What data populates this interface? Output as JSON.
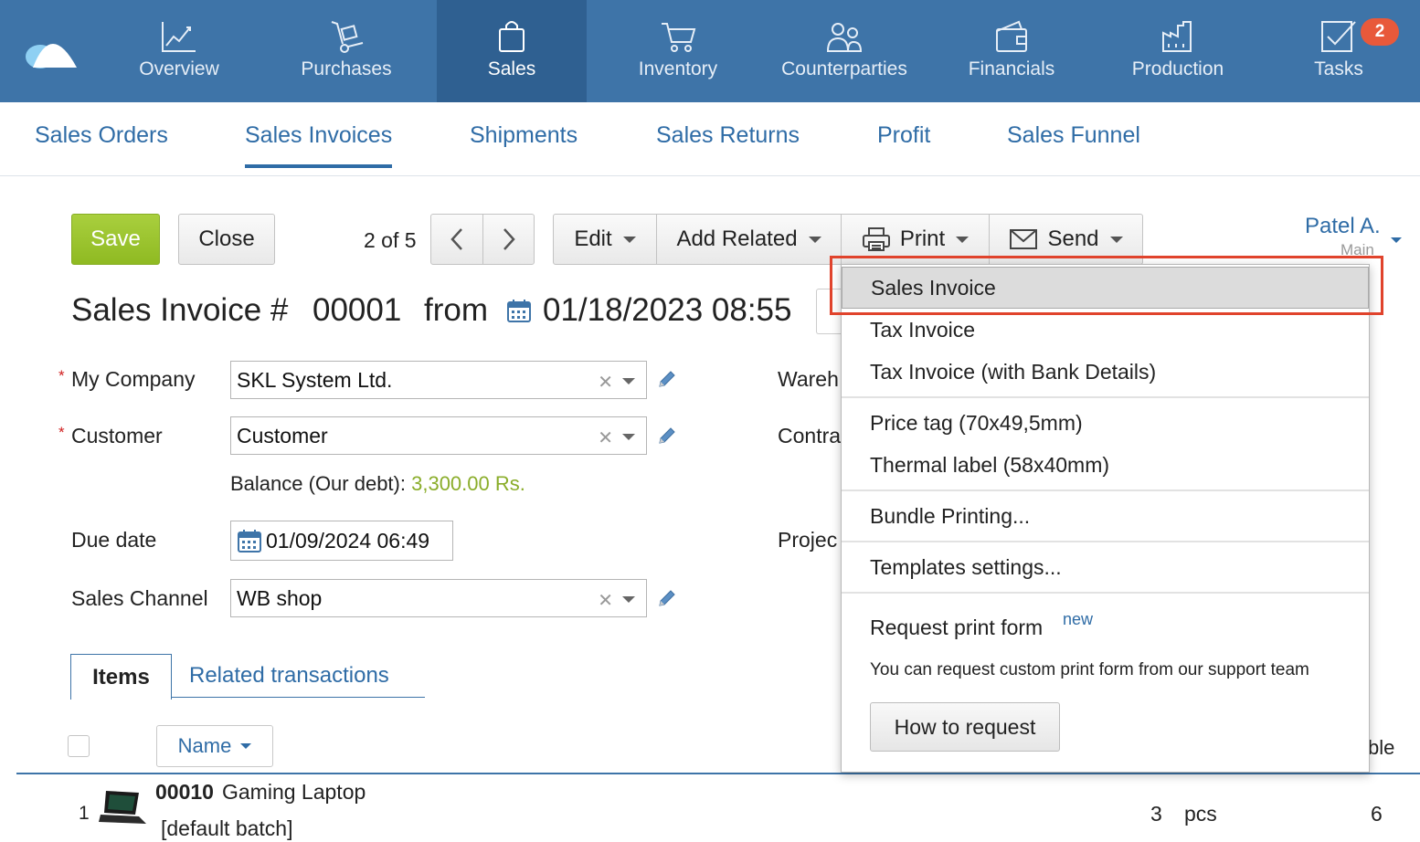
{
  "nav": {
    "items": [
      {
        "label": "Overview",
        "icon": "chart-line-icon"
      },
      {
        "label": "Purchases",
        "icon": "hand-truck-icon"
      },
      {
        "label": "Sales",
        "icon": "shopping-bag-icon"
      },
      {
        "label": "Inventory",
        "icon": "shopping-cart-icon"
      },
      {
        "label": "Counterparties",
        "icon": "people-icon"
      },
      {
        "label": "Financials",
        "icon": "wallet-icon"
      },
      {
        "label": "Production",
        "icon": "factory-icon"
      },
      {
        "label": "Tasks",
        "icon": "checkbox-icon"
      }
    ],
    "active": "Sales",
    "tasks_badge": "2"
  },
  "subnav": {
    "items": [
      "Sales Orders",
      "Sales Invoices",
      "Shipments",
      "Sales Returns",
      "Profit",
      "Sales Funnel"
    ],
    "active": "Sales Invoices"
  },
  "toolbar": {
    "save": "Save",
    "close": "Close",
    "pager": "2 of 5",
    "edit": "Edit",
    "add_related": "Add Related",
    "print": "Print",
    "send": "Send"
  },
  "user": {
    "name": "Patel A.",
    "sub": "Main"
  },
  "title": {
    "prefix": "Sales Invoice #",
    "number": "00001",
    "from": "from",
    "datetime": "01/18/2023 08:55"
  },
  "form": {
    "my_company_label": "My Company",
    "my_company_value": "SKL System Ltd.",
    "customer_label": "Customer",
    "customer_value": "Customer",
    "balance_label": "Balance (Our debt):",
    "balance_value": "3,300.00 Rs.",
    "due_date_label": "Due date",
    "due_date_value": "01/09/2024 06:49",
    "sales_channel_label": "Sales Channel",
    "sales_channel_value": "WB shop",
    "warehouse_label": "Wareh",
    "contract_label": "Contra",
    "project_label": "Projec",
    "required_mark": "*",
    "clear_mark": "✕"
  },
  "tabs": {
    "items": "Items",
    "related": "Related transactions"
  },
  "table": {
    "name_header": "Name",
    "right_header_partial": "ble",
    "rows": [
      {
        "index": "1",
        "code": "00010",
        "name": "Gaming Laptop",
        "batch": "[default batch]",
        "qty": "3",
        "unit": "pcs",
        "available": "6"
      }
    ]
  },
  "print_menu": {
    "items": [
      "Sales Invoice",
      "Tax Invoice",
      "Tax Invoice (with Bank Details)",
      "Price tag (70x49,5mm)",
      "Thermal label (58x40mm)",
      "Bundle Printing...",
      "Templates settings...",
      "Request print form"
    ],
    "new_badge": "new",
    "help_text": "You can request custom print form from our support team",
    "how_to_button": "How to request",
    "selected": "Sales Invoice"
  },
  "colors": {
    "nav_bg": "#3e74a8",
    "nav_active": "#2f6091",
    "link": "#2f6ca6",
    "save_green": "#9cc530",
    "badge_red": "#e8593a",
    "highlight_red": "#e0432c"
  }
}
